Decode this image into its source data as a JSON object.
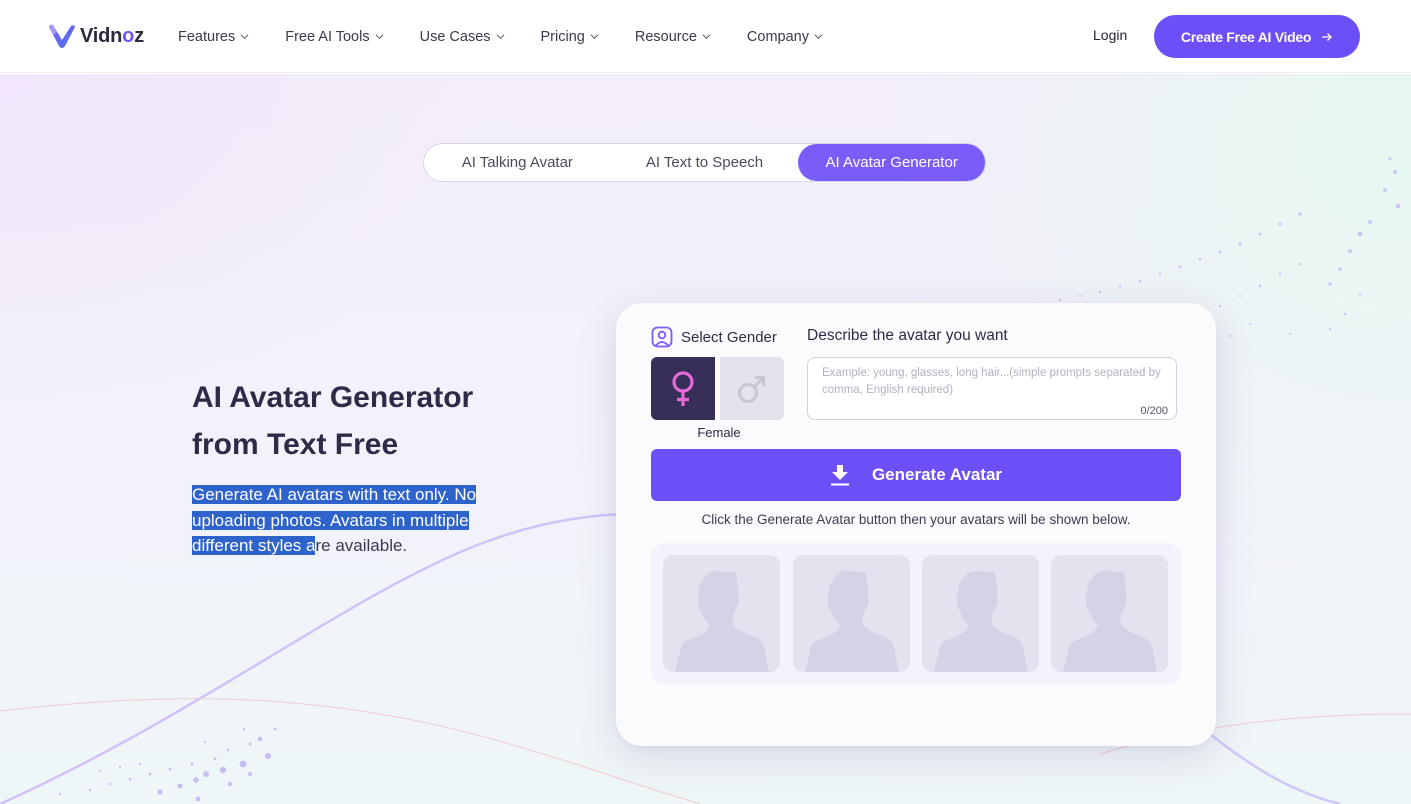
{
  "header": {
    "brand": {
      "name_prefix": "Vidn",
      "name_o": "o",
      "name_suffix": "z"
    },
    "nav": [
      {
        "label": "Features"
      },
      {
        "label": "Free AI Tools"
      },
      {
        "label": "Use Cases"
      },
      {
        "label": "Pricing"
      },
      {
        "label": "Resource"
      },
      {
        "label": "Company"
      }
    ],
    "login_label": "Login",
    "cta_label": "Create Free AI Video",
    "cta_icon": "arrow-right-icon"
  },
  "tabs": [
    {
      "label": "AI Talking Avatar",
      "active": false
    },
    {
      "label": "AI Text to Speech",
      "active": false
    },
    {
      "label": "AI Avatar Generator",
      "active": true
    }
  ],
  "hero": {
    "title_line1": "AI Avatar Generator",
    "title_line2": "from Text Free",
    "desc_selected": "Generate AI avatars with text only. No uploading photos. Avatars in multiple different styles a",
    "desc_rest": "re available."
  },
  "card": {
    "gender_label": "Select Gender",
    "gender_icon": "user-portrait-icon",
    "genders": [
      {
        "id": "female",
        "symbol": "♀",
        "selected": true
      },
      {
        "id": "male",
        "symbol": "♂",
        "selected": false
      }
    ],
    "selected_gender_caption": "Female",
    "describe_label": "Describe the avatar you want",
    "describe_placeholder": "Example: young, glasses, long hair...(simple prompts separated by comma, English required)",
    "describe_value": "",
    "char_count": "0/200",
    "generate_label": "Generate Avatar",
    "generate_icon": "download-icon",
    "hint": "Click the Generate Avatar button then your avatars will be shown below.",
    "placeholder_avatars": 4
  },
  "colors": {
    "brand": "#6c4ff6",
    "tab_active": "#7a5cf8",
    "female_bg": "#372f57",
    "female_symbol": "#e66ad9",
    "male_bg": "#e4e3ec",
    "male_symbol": "#c7c6d3",
    "selection": "#2f63cc"
  }
}
